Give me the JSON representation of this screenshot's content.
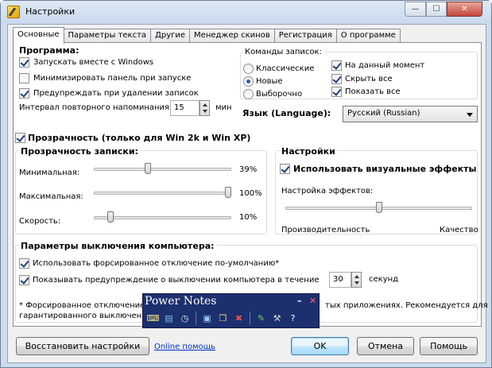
{
  "window": {
    "title": "Настройки",
    "min_glyph": "—",
    "max_glyph": "☐",
    "close_glyph": "✕"
  },
  "tabs": [
    {
      "label": "Основные",
      "active": true
    },
    {
      "label": "Параметры текста"
    },
    {
      "label": "Другие"
    },
    {
      "label": "Менеджер скинов"
    },
    {
      "label": "Регистрация"
    },
    {
      "label": "О программе"
    }
  ],
  "program": {
    "header": "Программа:",
    "start_with_windows": {
      "label": "Запускать вместе с Windows",
      "checked": true
    },
    "minimize_on_start": {
      "label": "Минимизировать панель при запуске",
      "checked": false
    },
    "warn_on_delete": {
      "label": "Предупреждать при удалении записок",
      "checked": true
    },
    "interval_label": "Интервал повторного напоминания",
    "interval_value": "15",
    "interval_unit": "мин"
  },
  "note_commands": {
    "header": "Команды записок:",
    "radios": [
      {
        "label": "Классические",
        "checked": false
      },
      {
        "label": "Новые",
        "checked": true
      },
      {
        "label": "Выборочно",
        "checked": false
      }
    ],
    "checks": [
      {
        "label": "На данный момент",
        "checked": true
      },
      {
        "label": "Скрыть все",
        "checked": true
      },
      {
        "label": "Показать все",
        "checked": true
      }
    ]
  },
  "language": {
    "label": "Язык (Language):",
    "value": "Русский (Russian)"
  },
  "transparency": {
    "label": "Прозрачность (только для Win 2k и Win XP)",
    "checked": true,
    "group_header": "Прозрачность записки:",
    "sliders": [
      {
        "label": "Минимальная:",
        "value_text": "39%",
        "fraction": 0.39
      },
      {
        "label": "Максимальная:",
        "value_text": "100%",
        "fraction": 1.0
      },
      {
        "label": "Скорость:",
        "value_text": "10%",
        "fraction": 0.1
      }
    ]
  },
  "settings": {
    "header": "Настройки",
    "visual_effects": {
      "label": "Использовать визуальные эффекты",
      "checked": true
    },
    "effects_label": "Настройка эффектов:",
    "effects_fraction": 0.5,
    "left_caption": "Производительность",
    "right_caption": "Качество"
  },
  "shutdown": {
    "header": "Параметры выключения компьютера:",
    "force": {
      "label": "Использовать форсированное отключение по-умолчанию*",
      "checked": true
    },
    "warn": {
      "label": "Показывать предупреждение о выключении компьютера в течение",
      "checked": true
    },
    "seconds_value": "30",
    "seconds_unit": "секунд",
    "footnote_left_1": "* Форсированное отключение",
    "footnote_left_2": "гарантированного выключени",
    "footnote_right": "тых приложениях. Рекомендуется для"
  },
  "buttons": {
    "restore": "Восстановить настройки",
    "online_help": "Online помощь",
    "ok": "OK",
    "cancel": "Отмена",
    "help": "Помощь"
  },
  "power_notes": {
    "title": "Power Notes",
    "min_glyph": "–",
    "close_glyph": "✕",
    "icons": [
      {
        "name": "keyboard-icon",
        "glyph": "⌨",
        "color": "#f5e27a"
      },
      {
        "name": "new-note-icon",
        "glyph": "▤",
        "color": "#6fc3f2"
      },
      {
        "name": "note-clock-icon",
        "glyph": "◷",
        "color": "#e9e9e9"
      },
      {
        "name": "screen-icon",
        "glyph": "▣",
        "color": "#9ad0f5"
      },
      {
        "name": "notes-stack-icon",
        "glyph": "❐",
        "color": "#f5d46b"
      },
      {
        "name": "delete-note-icon",
        "glyph": "✖",
        "color": "#e35050"
      },
      {
        "name": "pen-icon",
        "glyph": "✎",
        "color": "#6fd36f"
      },
      {
        "name": "tools-icon",
        "glyph": "⚒",
        "color": "#d8d8d8"
      },
      {
        "name": "help-icon",
        "glyph": "?",
        "color": "#ffffff"
      }
    ]
  }
}
